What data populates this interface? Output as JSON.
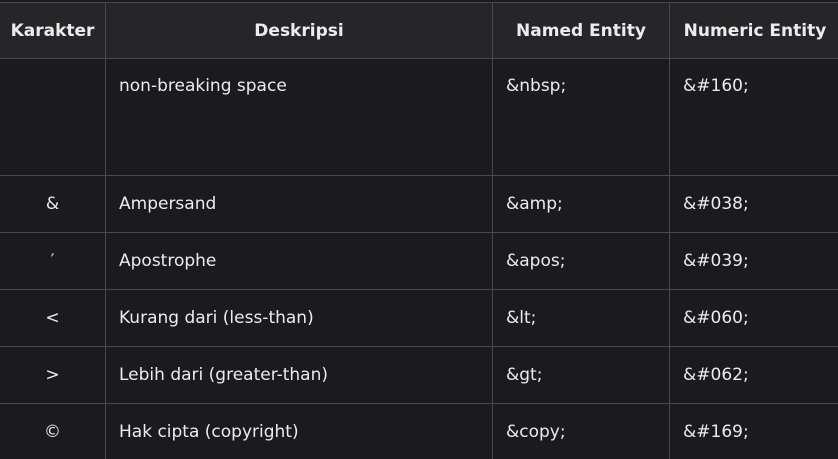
{
  "table": {
    "headers": [
      "Karakter",
      "Deskripsi",
      "Named Entity",
      "Numeric Entity"
    ],
    "rows": [
      {
        "char": " ",
        "desc": "non-breaking space",
        "named": "&nbsp;",
        "numeric": "&#160;"
      },
      {
        "char": "&",
        "desc": "Ampersand",
        "named": "&amp;",
        "numeric": "&#038;"
      },
      {
        "char": "′",
        "desc": "Apostrophe",
        "named": "&apos;",
        "numeric": "&#039;"
      },
      {
        "char": "<",
        "desc": "Kurang dari (less-than)",
        "named": "&lt;",
        "numeric": "&#060;"
      },
      {
        "char": ">",
        "desc": "Lebih dari (greater-than)",
        "named": "&gt;",
        "numeric": "&#062;"
      },
      {
        "char": "©",
        "desc": "Hak cipta (copyright)",
        "named": "&copy;",
        "numeric": "&#169;"
      }
    ]
  }
}
